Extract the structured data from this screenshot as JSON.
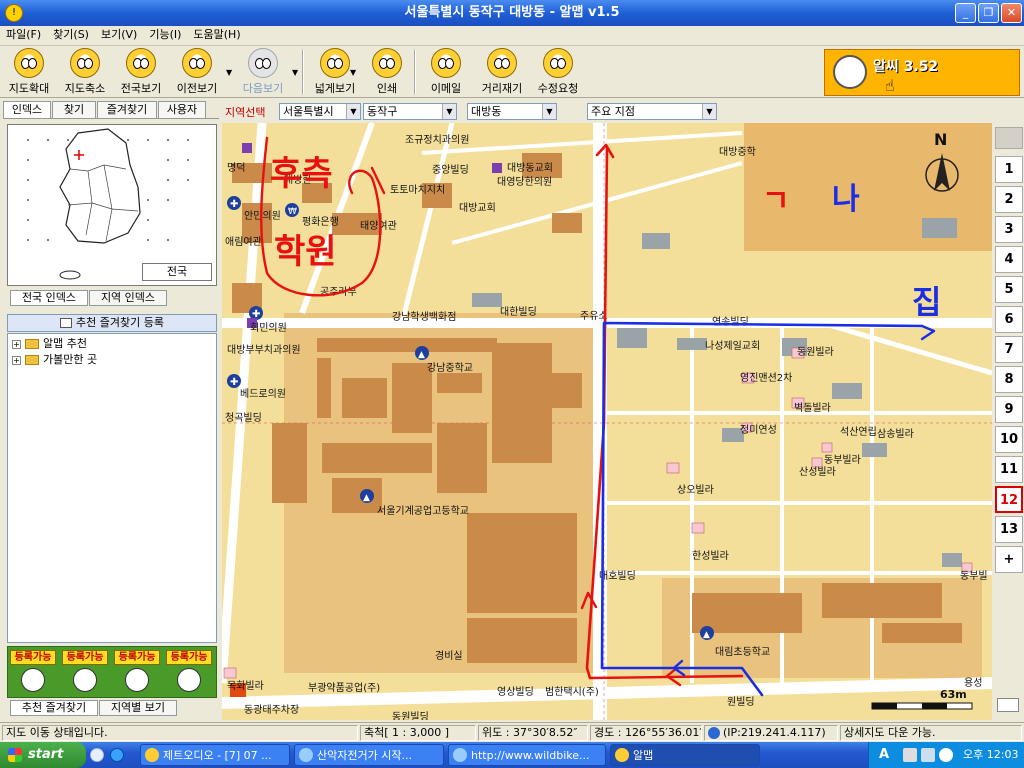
{
  "window": {
    "title": "서울특별시 동작구 대방동 - 알맵 v1.5",
    "icon_label": "!",
    "minimize": "_",
    "restore": "❐",
    "close": "✕"
  },
  "menu": [
    "파일(F)",
    "찾기(S)",
    "보기(V)",
    "기능(I)",
    "도움말(H)"
  ],
  "toolbar": [
    {
      "label": "지도확대",
      "name": "zoom-in-button"
    },
    {
      "label": "지도축소",
      "name": "zoom-out-button"
    },
    {
      "label": "전국보기",
      "name": "national-view-button"
    },
    {
      "label": "이전보기",
      "name": "previous-view-button"
    },
    {
      "label": "다음보기",
      "name": "next-view-button"
    },
    {
      "label": "넓게보기",
      "name": "wide-view-button"
    },
    {
      "label": "인쇄",
      "name": "print-button"
    },
    {
      "label": "이메일",
      "name": "email-button"
    },
    {
      "label": "거리재기",
      "name": "measure-distance-button"
    },
    {
      "label": "수정요청",
      "name": "correction-request-button"
    }
  ],
  "ad": {
    "text": "알씨 3.52"
  },
  "left_tabs": [
    "인덱스",
    "찾기",
    "즐겨찾기",
    "사용자"
  ],
  "minimap": {
    "button": "전국"
  },
  "index_tabs": [
    "전국 인덱스",
    "지역 인덱스"
  ],
  "favorites": {
    "header": "추천 즐겨찾기 등록",
    "items": [
      "알맵 추천",
      "가볼만한 곳"
    ]
  },
  "register_label": "등록가능",
  "bottom_tabs": [
    "추천 즐겨찾기",
    "지역별 보기"
  ],
  "region": {
    "label": "지역선택",
    "city": "서울특별시",
    "district": "동작구",
    "dong": "대방동",
    "poi": "주요 지점"
  },
  "map": {
    "labels": {
      "l1": "조규정치과의원",
      "l2": "대방중학",
      "l3": "명덕",
      "l4": "중앙빌딩",
      "l5": "대방한",
      "l6": "대방동교회",
      "l7": "대영당한의원",
      "l8": "토토마치지치",
      "l9": "대방교회",
      "l10": "안민의원",
      "l11": "평화은행",
      "l12": "태양여관",
      "l13": "애림여관",
      "l14": "공주라부",
      "l15": "강남학생백화점",
      "l16": "대한빌딩",
      "l17": "주유소",
      "l18": "연송빌딩",
      "l19": "나성제일교회",
      "l20": "동원빌라",
      "l21": "영진맨션2차",
      "l22": "대방부부치과의원",
      "l23": "강남중학교",
      "l24": "베드로의원",
      "l25": "벽돌빌라",
      "l26": "청곡빌딩",
      "l27": "정미연성",
      "l28": "석산연립",
      "l29": "삼송빌라",
      "l30": "동부빌라",
      "l31": "산성빌라",
      "l32": "상오빌라",
      "l33": "서울기계공업고등학교",
      "l34": "한성빌라",
      "l35": "대호빌딩",
      "l36": "대림초등학교",
      "l37": "경비실",
      "l38": "동부빌",
      "l39": "부광약품공업(주)",
      "l40": "영상빌딩",
      "l41": "범한택시(주)",
      "l42": "원빌딩",
      "l43": "동광태주차장",
      "l44": "동원빌딩",
      "l45": "용성",
      "l46": "목화빌라",
      "l47": "회민의원"
    },
    "handwriting": {
      "left": "후측",
      "left2": "학원",
      "ga": "ㄱ",
      "na": "나",
      "home": "집"
    },
    "north": "N",
    "scale": "63m"
  },
  "zoom_levels": [
    "1",
    "2",
    "3",
    "4",
    "5",
    "6",
    "7",
    "8",
    "9",
    "10",
    "11",
    "12",
    "13",
    "+"
  ],
  "zoom_active": "12",
  "status": {
    "state": "지도 이동 상태입니다.",
    "scale": "축척[ 1 : 3,000 ]",
    "lat": "위도 : 37°30′8.52″",
    "lon": "경도 : 126°55′36.01″",
    "ip": "(IP:219.241.4.117)",
    "detail": "상세지도 다운 가능."
  },
  "taskbar": {
    "start": "start",
    "tasks": [
      "제트오디오 - [7] 07 ...",
      "산악자전거가 시작...",
      "http://www.wildbike...",
      "알맵"
    ],
    "tray_lang": "A",
    "clock": "오후 12:03"
  },
  "colors": {
    "title_blue": "#1f5fd6",
    "map_bg": "#f4df9a",
    "building": "#c98a4a",
    "red_ink": "#e81010",
    "blue_ink": "#1a2ee8"
  }
}
